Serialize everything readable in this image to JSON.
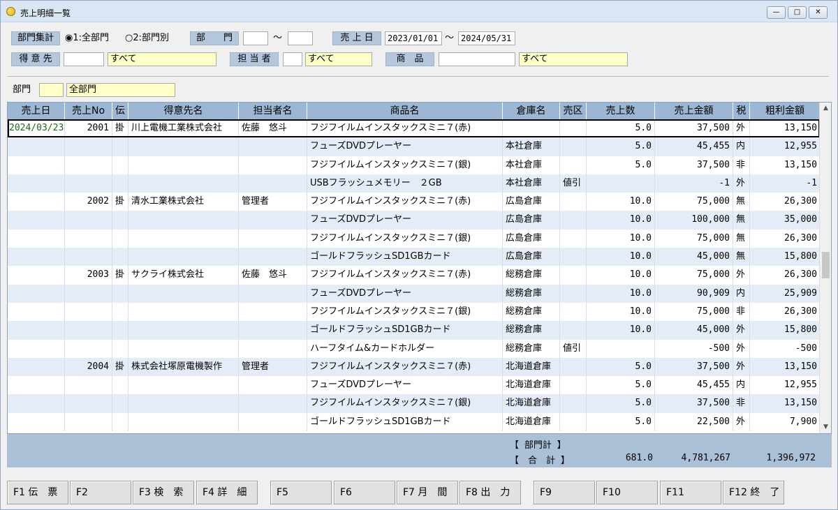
{
  "window": {
    "title": "売上明細一覧",
    "controls": {
      "minimize": "—",
      "maximize": "□",
      "close": "✕"
    }
  },
  "filters": {
    "dept_summary_label": "部門集計",
    "radio1_label": "1:全部門",
    "radio2_label": "2:部門別",
    "dept_label": "部　　門",
    "dept_from": "",
    "tilde": "～",
    "dept_to": "",
    "sales_date_label": "売 上 日",
    "date_from": "2023/01/01",
    "date_to": "2024/05/31",
    "customer_label": "得 意 先",
    "customer_code": "",
    "customer_name": "すべて",
    "staff_label": "担 当 者",
    "staff_code": "",
    "staff_name": "すべて",
    "product_label": "商　品",
    "product_code": "",
    "product_name": "すべて",
    "dept_row_label": "部門",
    "dept_row_code": "",
    "dept_row_name": "全部門"
  },
  "grid": {
    "headers": [
      "売上日",
      "売上No",
      "伝",
      "得意先名",
      "担当者名",
      "商品名",
      "倉庫名",
      "売区",
      "売上数",
      "売上金額",
      "税",
      "粗利金額"
    ],
    "rows": [
      [
        "2024/03/23",
        "2001",
        "掛",
        "川上電機工業株式会社",
        "佐藤　悠斗",
        "フジフイルムインスタックスミニ７(赤)",
        "",
        "",
        "5.0",
        "37,500",
        "外",
        "13,150"
      ],
      [
        "",
        "",
        "",
        "",
        "",
        "フューズDVDプレーヤー",
        "本社倉庫",
        "",
        "5.0",
        "45,455",
        "内",
        "12,955"
      ],
      [
        "",
        "",
        "",
        "",
        "",
        "フジフイルムインスタックスミニ７(銀)",
        "本社倉庫",
        "",
        "5.0",
        "37,500",
        "非",
        "13,150"
      ],
      [
        "",
        "",
        "",
        "",
        "",
        "USBフラッシュメモリー　２GB",
        "本社倉庫",
        "値引",
        "",
        "-1",
        "外",
        "-1"
      ],
      [
        "",
        "2002",
        "掛",
        "清水工業株式会社",
        "管理者",
        "フジフイルムインスタックスミニ７(赤)",
        "広島倉庫",
        "",
        "10.0",
        "75,000",
        "無",
        "26,300"
      ],
      [
        "",
        "",
        "",
        "",
        "",
        "フューズDVDプレーヤー",
        "広島倉庫",
        "",
        "10.0",
        "100,000",
        "無",
        "35,000"
      ],
      [
        "",
        "",
        "",
        "",
        "",
        "フジフイルムインスタックスミニ７(銀)",
        "広島倉庫",
        "",
        "10.0",
        "75,000",
        "無",
        "26,300"
      ],
      [
        "",
        "",
        "",
        "",
        "",
        "ゴールドフラッシュSD1GBカード",
        "広島倉庫",
        "",
        "10.0",
        "45,000",
        "無",
        "15,800"
      ],
      [
        "",
        "2003",
        "掛",
        "サクライ株式会社",
        "佐藤　悠斗",
        "フジフイルムインスタックスミニ７(赤)",
        "総務倉庫",
        "",
        "10.0",
        "75,000",
        "外",
        "26,300"
      ],
      [
        "",
        "",
        "",
        "",
        "",
        "フューズDVDプレーヤー",
        "総務倉庫",
        "",
        "10.0",
        "90,909",
        "内",
        "25,909"
      ],
      [
        "",
        "",
        "",
        "",
        "",
        "フジフイルムインスタックスミニ７(銀)",
        "総務倉庫",
        "",
        "10.0",
        "75,000",
        "非",
        "26,300"
      ],
      [
        "",
        "",
        "",
        "",
        "",
        "ゴールドフラッシュSD1GBカード",
        "総務倉庫",
        "",
        "10.0",
        "45,000",
        "外",
        "15,800"
      ],
      [
        "",
        "",
        "",
        "",
        "",
        "ハーフタイム&カードホルダー",
        "総務倉庫",
        "値引",
        "",
        "-500",
        "外",
        "-500"
      ],
      [
        "",
        "2004",
        "掛",
        "株式会社塚原電機製作",
        "管理者",
        "フジフイルムインスタックスミニ７(赤)",
        "北海道倉庫",
        "",
        "5.0",
        "37,500",
        "外",
        "13,150"
      ],
      [
        "",
        "",
        "",
        "",
        "",
        "フューズDVDプレーヤー",
        "北海道倉庫",
        "",
        "5.0",
        "45,455",
        "内",
        "12,955"
      ],
      [
        "",
        "",
        "",
        "",
        "",
        "フジフイルムインスタックスミニ７(銀)",
        "北海道倉庫",
        "",
        "5.0",
        "37,500",
        "非",
        "13,150"
      ],
      [
        "",
        "",
        "",
        "",
        "",
        "ゴールドフラッシュSD1GBカード",
        "北海道倉庫",
        "",
        "5.0",
        "22,500",
        "外",
        "7,900"
      ]
    ]
  },
  "totals": {
    "dept_total_label": "【 部門計 】",
    "grand_total_label": "【　合　計 】",
    "qty": "681.0",
    "amount": "4,781,267",
    "profit": "1,396,972"
  },
  "fkeys": [
    "F1 伝　票",
    "F2",
    "F3 検　索",
    "F4 詳　細",
    "F5",
    "F6",
    "F7 月　間",
    "F8 出　力",
    "F9",
    "F10",
    "F11",
    "F12 終　了"
  ]
}
